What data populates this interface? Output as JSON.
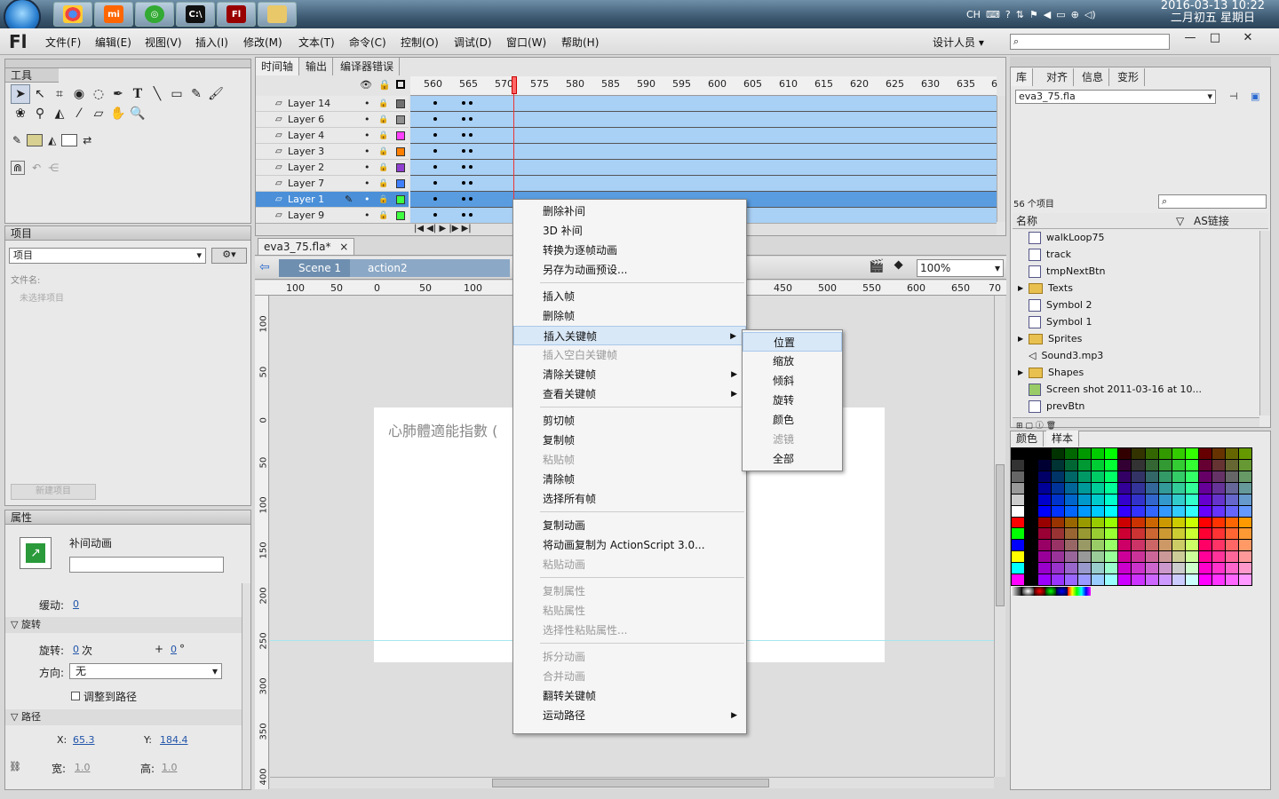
{
  "taskbar": {
    "tray_lang": "CH",
    "clock_time": "2016-03-13 10:22",
    "clock_date": "二月初五 星期日",
    "apps": [
      "chrome",
      "mi",
      "android",
      "terminal",
      "flash",
      "explorer"
    ]
  },
  "menubar": {
    "logo": "Fl",
    "items": [
      "文件(F)",
      "编辑(E)",
      "视图(V)",
      "插入(I)",
      "修改(M)",
      "文本(T)",
      "命令(C)",
      "控制(O)",
      "调试(D)",
      "窗口(W)",
      "帮助(H)"
    ],
    "workspace": "设计人员 ▾",
    "window_buttons": [
      "—",
      "□",
      "✕"
    ]
  },
  "tools_panel": {
    "title": "工具"
  },
  "project_panel": {
    "title": "项目",
    "dropdown": "项目",
    "file_label": "文件名:",
    "placeholder_item": "未选择项目",
    "button": "新建项目"
  },
  "props_panel": {
    "title": "属性",
    "object_type": "补间动画",
    "easing_label": "缓动:",
    "easing_value": "0",
    "rotation_section": "旋转",
    "rotate_label": "旋转:",
    "rotate_times": "0",
    "rotate_unit": "次",
    "rotate_plus": "+",
    "rotate_deg": "0",
    "rotate_deg_unit": "°",
    "direction_label": "方向:",
    "direction_value": "无",
    "orient_label": "调整到路径",
    "path_section": "路径",
    "x_label": "X:",
    "x_value": "65.3",
    "y_label": "Y:",
    "y_value": "184.4",
    "w_label": "宽:",
    "w_value": "1.0",
    "h_label": "高:",
    "h_value": "1.0"
  },
  "timeline": {
    "tabs": [
      "时间轴",
      "输出",
      "编译器错误"
    ],
    "frame_numbers": [
      "560",
      "565",
      "570",
      "575",
      "580",
      "585",
      "590",
      "595",
      "600",
      "605",
      "610",
      "615",
      "620",
      "625",
      "630",
      "635",
      "6"
    ],
    "layers": [
      {
        "name": "Layer 14",
        "color": "#707070"
      },
      {
        "name": "Layer 6",
        "color": "#909090"
      },
      {
        "name": "Layer 4",
        "color": "#ff40ff"
      },
      {
        "name": "Layer 3",
        "color": "#ff8000"
      },
      {
        "name": "Layer 2",
        "color": "#9040d0"
      },
      {
        "name": "Layer 7",
        "color": "#4080ff"
      },
      {
        "name": "Layer 1",
        "color": "#40ff40",
        "selected": true
      },
      {
        "name": "Layer 9",
        "color": "#40ff40"
      }
    ]
  },
  "document": {
    "tab": "eva3_75.fla*",
    "tab_close": "×",
    "scene": "Scene 1",
    "symbol": "action2",
    "zoom": "100%",
    "stage_text": "心肺體適能指數 (",
    "h_ruler": [
      "100",
      "50",
      "0",
      "50",
      "100",
      "450",
      "500",
      "550",
      "600",
      "650",
      "70"
    ],
    "v_ruler": [
      "100",
      "50",
      "0",
      "50",
      "100",
      "150",
      "200",
      "250",
      "300",
      "350",
      "400"
    ]
  },
  "context_menu": {
    "items": [
      {
        "label": "删除补间",
        "disabled": false
      },
      {
        "label": "3D 补间",
        "disabled": false
      },
      {
        "label": "转换为逐帧动画",
        "disabled": false
      },
      {
        "label": "另存为动画预设...",
        "disabled": false
      },
      {
        "label": "插入帧",
        "disabled": false
      },
      {
        "label": "删除帧",
        "disabled": false
      },
      {
        "label": "插入关键帧",
        "disabled": false,
        "submenu": true,
        "highlight": true
      },
      {
        "label": "插入空白关键帧",
        "disabled": true
      },
      {
        "label": "清除关键帧",
        "disabled": false,
        "submenu": true
      },
      {
        "label": "查看关键帧",
        "disabled": false,
        "submenu": true
      },
      {
        "label": "剪切帧",
        "disabled": false
      },
      {
        "label": "复制帧",
        "disabled": false
      },
      {
        "label": "粘贴帧",
        "disabled": true
      },
      {
        "label": "清除帧",
        "disabled": false
      },
      {
        "label": "选择所有帧",
        "disabled": false
      },
      {
        "label": "复制动画",
        "disabled": false
      },
      {
        "label": "将动画复制为 ActionScript 3.0...",
        "disabled": false
      },
      {
        "label": "粘贴动画",
        "disabled": true
      },
      {
        "label": "复制属性",
        "disabled": true
      },
      {
        "label": "粘贴属性",
        "disabled": true
      },
      {
        "label": "选择性粘贴属性...",
        "disabled": true
      },
      {
        "label": "拆分动画",
        "disabled": true
      },
      {
        "label": "合并动画",
        "disabled": true
      },
      {
        "label": "翻转关键帧",
        "disabled": false
      },
      {
        "label": "运动路径",
        "disabled": false,
        "submenu": true
      }
    ],
    "submenu_arrow": "▶"
  },
  "submenu": {
    "items": [
      {
        "label": "位置",
        "highlight": true
      },
      {
        "label": "缩放"
      },
      {
        "label": "倾斜"
      },
      {
        "label": "旋转"
      },
      {
        "label": "颜色"
      },
      {
        "label": "滤镜",
        "disabled": true
      },
      {
        "label": "全部"
      }
    ]
  },
  "library": {
    "tabs": [
      "库",
      "对齐",
      "信息",
      "变形"
    ],
    "file": "eva3_75.fla",
    "count": "56 个项目",
    "col_name": "名称",
    "col_link": "AS链接",
    "items": [
      {
        "name": "walkLoop75",
        "type": "symbol"
      },
      {
        "name": "track",
        "type": "symbol"
      },
      {
        "name": "tmpNextBtn",
        "type": "symbol"
      },
      {
        "name": "Texts",
        "type": "folder"
      },
      {
        "name": "Symbol 2",
        "type": "symbol"
      },
      {
        "name": "Symbol 1",
        "type": "symbol"
      },
      {
        "name": "Sprites",
        "type": "folder"
      },
      {
        "name": "Sound3.mp3",
        "type": "sound"
      },
      {
        "name": "Shapes",
        "type": "folder"
      },
      {
        "name": "Screen shot 2011-03-16 at 10...",
        "type": "bitmap"
      },
      {
        "name": "prevBtn",
        "type": "symbol"
      }
    ]
  },
  "color_panel": {
    "tabs": [
      "颜色",
      "样本"
    ]
  }
}
